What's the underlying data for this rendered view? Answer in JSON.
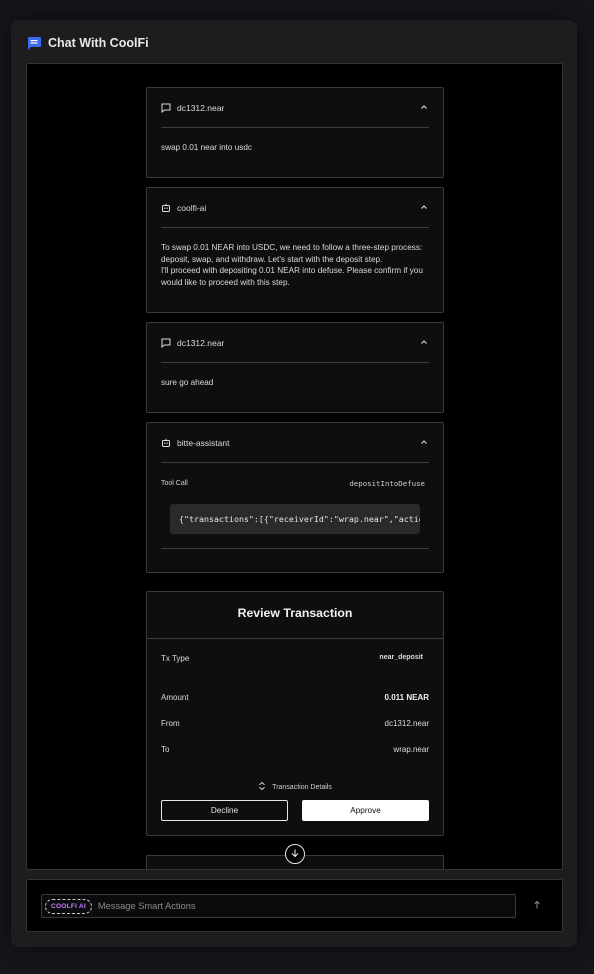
{
  "header": {
    "title": "Chat With CoolFi",
    "icon": "chat-bubble-icon"
  },
  "messages": [
    {
      "author": "dc1312.near",
      "icon": "speech-bubble-icon",
      "text": "swap 0.01 near into usdc"
    },
    {
      "author": "coolfi-ai",
      "icon": "bot-icon",
      "text_lines": [
        "To swap 0.01 NEAR into USDC, we need to follow a three-step process:",
        "deposit, swap, and withdraw. Let's start with the deposit step.",
        "I'll proceed with depositing 0.01 NEAR into defuse. Please confirm if you",
        "would like to proceed with this step."
      ]
    },
    {
      "author": "dc1312.near",
      "icon": "speech-bubble-icon",
      "text": "sure go ahead"
    },
    {
      "author": "bitte-assistant",
      "icon": "bot-icon",
      "tool_label": "Tool Call",
      "tool_name": "depositIntoDefuse",
      "code": "{\"transactions\":[{\"receiverId\":\"wrap.near\",\"actions\":[{\"type\":\"FunctionCall\""
    }
  ],
  "review": {
    "title": "Review Transaction",
    "rows": [
      {
        "label": "Tx Type",
        "value": "near_deposit"
      },
      {
        "label": "Amount",
        "value": "0.011 NEAR"
      },
      {
        "label": "From",
        "value": "dc1312.near"
      },
      {
        "label": "To",
        "value": "wrap.near"
      }
    ],
    "details_label": "Transaction Details",
    "decline_label": "Decline",
    "approve_label": "Approve"
  },
  "input": {
    "badge": "COOLFI AI",
    "placeholder": "Message Smart Actions"
  },
  "colors": {
    "accent": "#3b6cf0",
    "badge": "#c77dff",
    "background": "#15151c"
  }
}
